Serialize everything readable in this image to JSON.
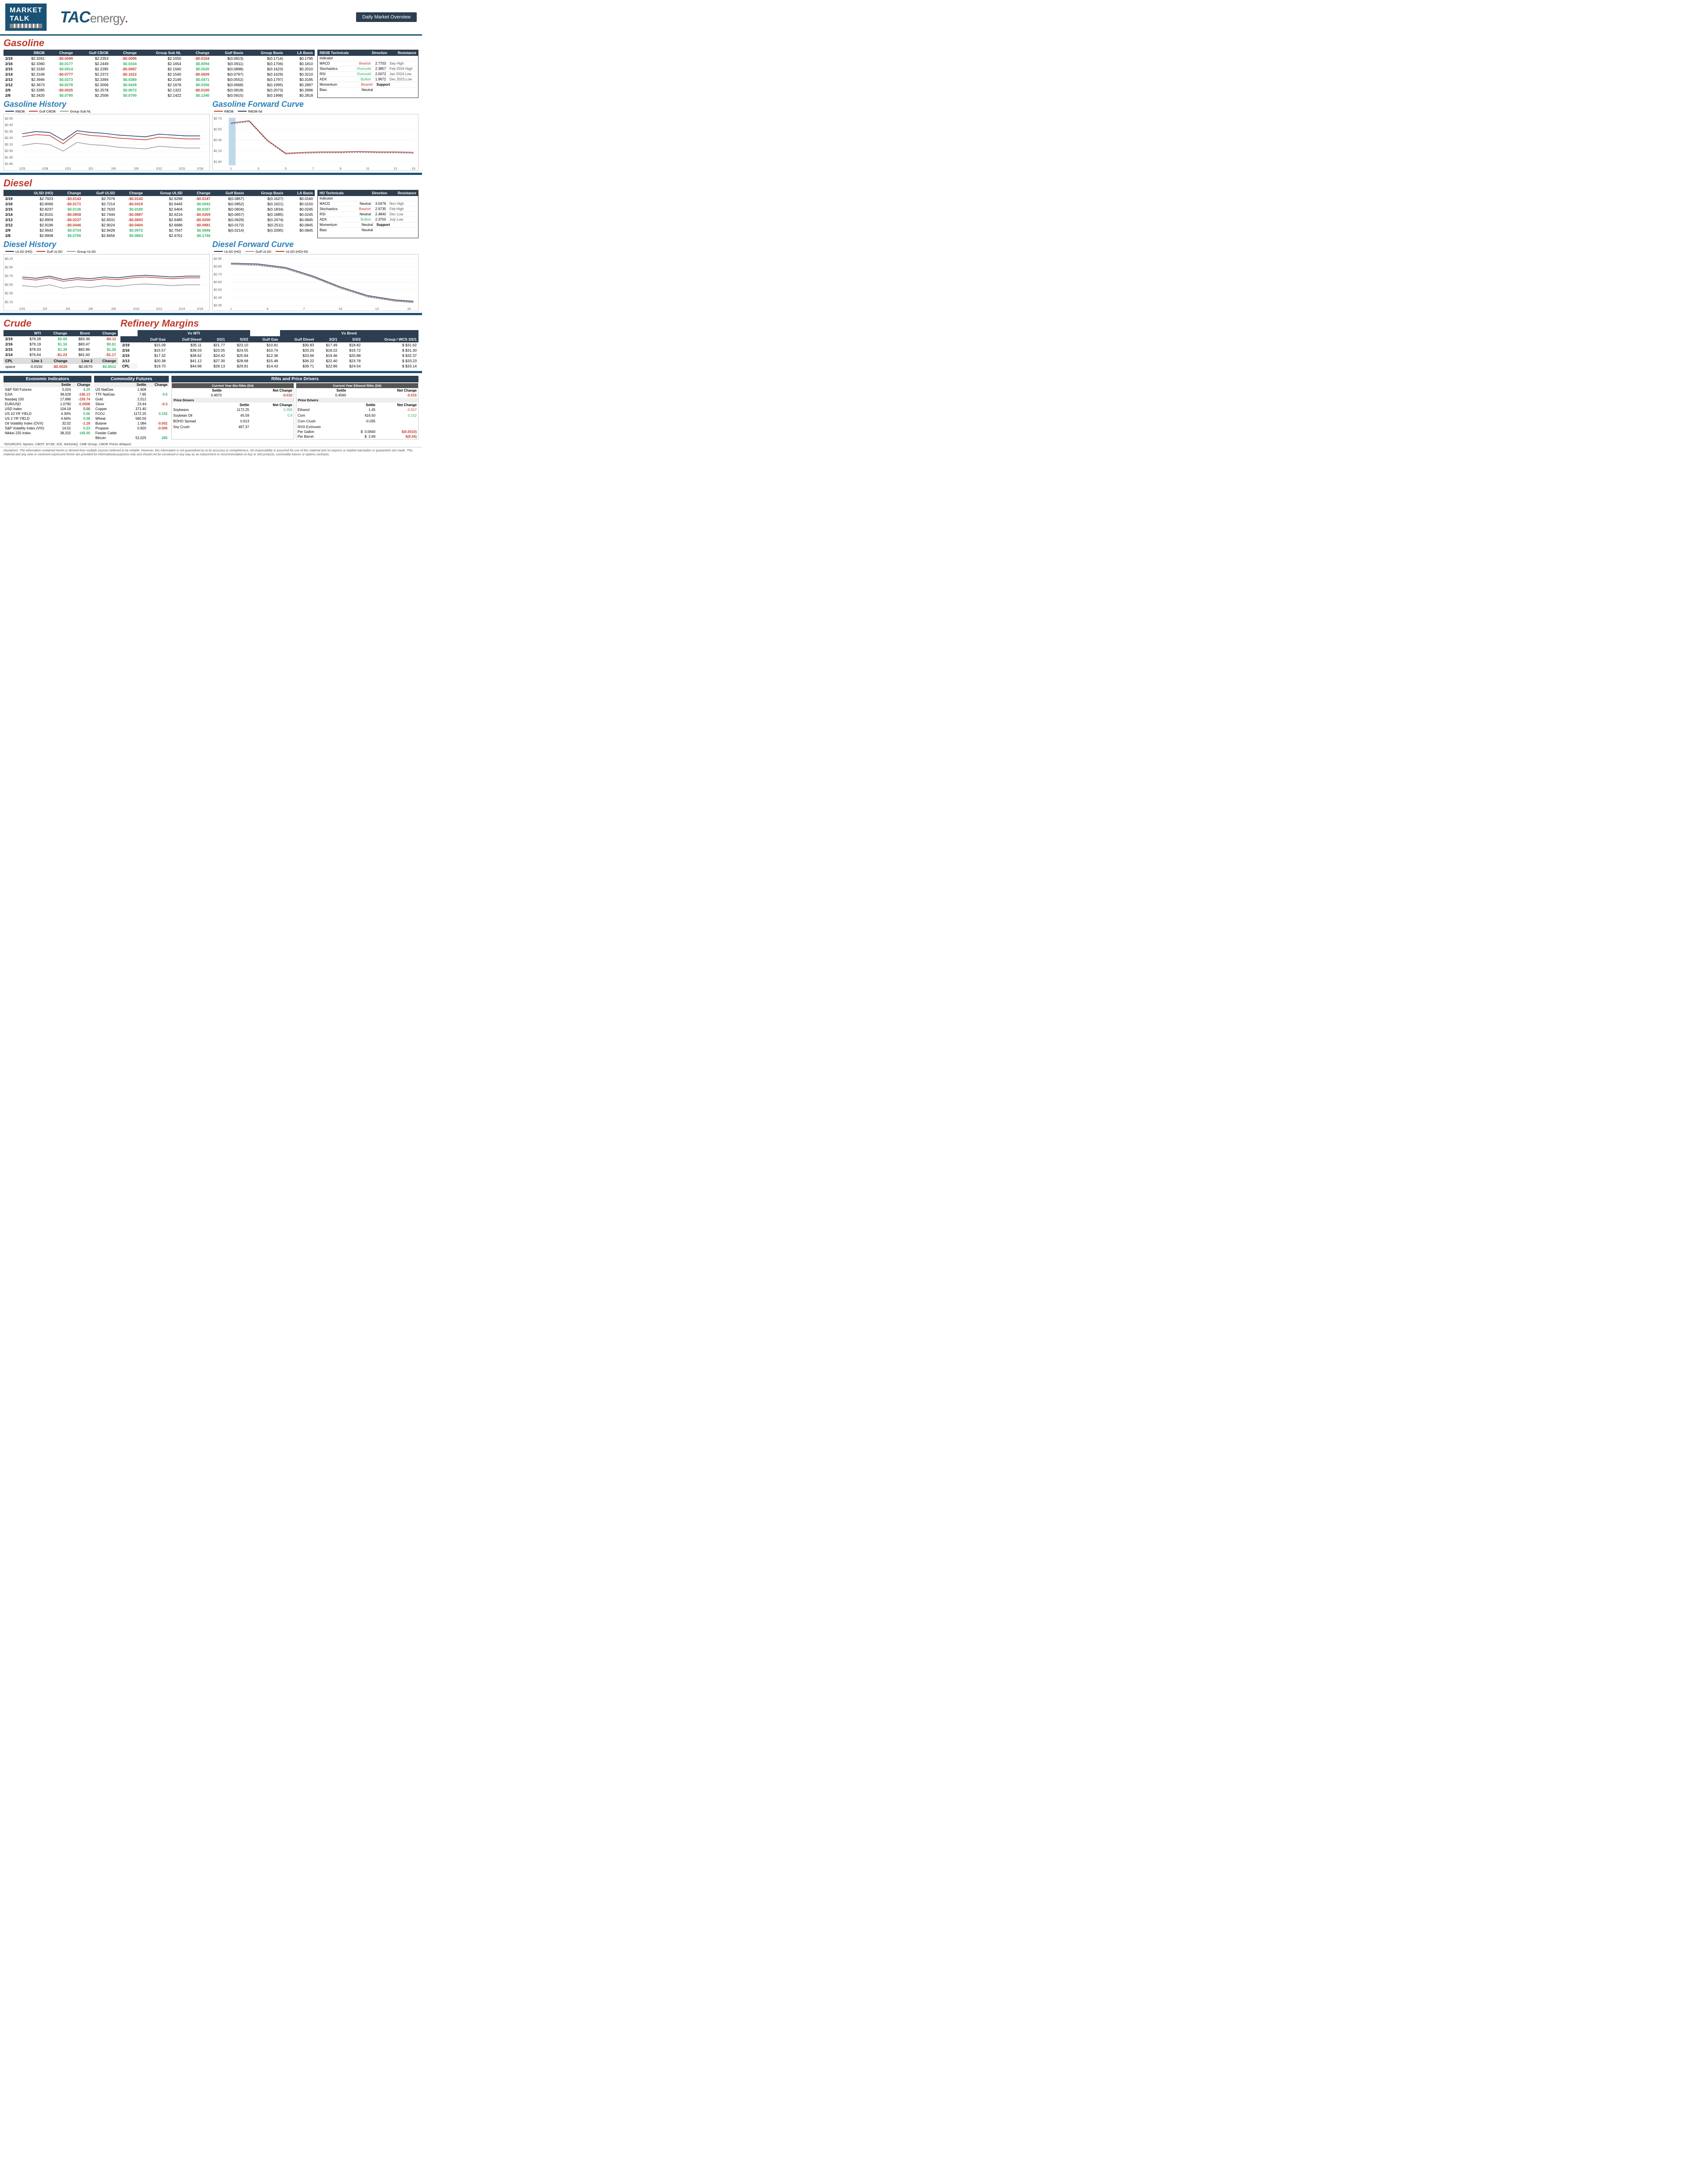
{
  "header": {
    "market_talk": "MARKET TALK",
    "tac_energy": "TACenergy.",
    "daily_overview": "Daily Market Overview"
  },
  "gasoline": {
    "title": "Gasoline",
    "columns": [
      "",
      "RBOB",
      "Change",
      "Gulf CBOB",
      "Change",
      "Group Sub NL",
      "Change",
      "Gulf Basis",
      "Group Basis",
      "LA Basis"
    ],
    "rows": [
      {
        "date": "2/19",
        "rbob": "$2.3261",
        "rbob_chg": "-$0.0099",
        "gulf_cbob": "$2.2353",
        "gulf_cbob_chg": "-$0.0096",
        "group_nl": "$2.1550",
        "group_nl_chg": "-$0.0104",
        "gulf_basis": "$(0.0913)",
        "group_basis": "$(0.1714)",
        "la_basis": "$0.1795"
      },
      {
        "date": "2/16",
        "rbob": "$2.3360",
        "rbob_chg": "$0.0177",
        "gulf_cbob": "$2.2449",
        "gulf_cbob_chg": "$0.0164",
        "group_nl": "$2.1654",
        "group_nl_chg": "$0.0094",
        "gulf_basis": "$(0.0911)",
        "group_basis": "$(0.1706)",
        "la_basis": "$0.1810"
      },
      {
        "date": "2/15",
        "rbob": "$2.3183",
        "rbob_chg": "$0.0014",
        "gulf_cbob": "$2.2285",
        "gulf_cbob_chg": "-$0.0087",
        "group_nl": "$2.1560",
        "group_nl_chg": "$0.0020",
        "gulf_basis": "$(0.0898)",
        "group_basis": "$(0.1623)",
        "la_basis": "$0.2010"
      },
      {
        "date": "2/14",
        "rbob": "$2.3169",
        "rbob_chg": "-$0.0777",
        "gulf_cbob": "$2.2372",
        "gulf_cbob_chg": "-$0.1022",
        "group_nl": "$2.1540",
        "group_nl_chg": "-$0.0609",
        "gulf_basis": "$(0.0797)",
        "group_basis": "$(0.1629)",
        "la_basis": "$0.3210"
      },
      {
        "date": "2/13",
        "rbob": "$2.3946",
        "rbob_chg": "$0.0273",
        "gulf_cbob": "$2.3394",
        "gulf_cbob_chg": "$0.0389",
        "group_nl": "$2.2149",
        "group_nl_chg": "$0.0471",
        "gulf_basis": "$(0.0552)",
        "group_basis": "$(0.1797)",
        "la_basis": "$0.3195"
      },
      {
        "date": "2/12",
        "rbob": "$2.3673",
        "rbob_chg": "$0.0278",
        "gulf_cbob": "$2.3006",
        "gulf_cbob_chg": "$0.0428",
        "group_nl": "$2.1678",
        "group_nl_chg": "$0.0356",
        "gulf_basis": "$(0.0668)",
        "group_basis": "$(0.1995)",
        "la_basis": "$0.2897"
      },
      {
        "date": "2/9",
        "rbob": "$2.3395",
        "rbob_chg": "-$0.0025",
        "gulf_cbob": "$2.2578",
        "gulf_cbob_chg": "$0.0072",
        "group_nl": "$2.1322",
        "group_nl_chg": "-$0.0100",
        "gulf_basis": "$(0.0818)",
        "group_basis": "$(0.2073)",
        "la_basis": "$0.2896"
      },
      {
        "date": "2/8",
        "rbob": "$2.3420",
        "rbob_chg": "$0.0790",
        "gulf_cbob": "$2.2506",
        "gulf_cbob_chg": "$0.0790",
        "group_nl": "$2.1422",
        "group_nl_chg": "$0.1340",
        "gulf_basis": "$(0.0915)",
        "group_basis": "$(0.1998)",
        "la_basis": "$0.2818"
      }
    ],
    "technicals": {
      "title": "RBOB Technicals",
      "headers": [
        "Indicator",
        "Direction",
        "Resistance"
      ],
      "rows": [
        {
          "indicator": "MACD",
          "direction": "Bearish",
          "value": "2.7703",
          "label": "Sep High"
        },
        {
          "indicator": "Stochastics",
          "direction": "Oversold",
          "value": "2.3857",
          "label": "Feb 2024 High"
        },
        {
          "indicator": "RSI",
          "direction": "Oversold",
          "value": "2.0072",
          "label": "Jan 2024 Low"
        },
        {
          "indicator": "ADX",
          "direction": "Bullish",
          "value": "1.9672",
          "label": "Dec 2023 Low"
        }
      ],
      "momentum": {
        "indicator": "Momentum",
        "direction": "Bearish",
        "section": "Support"
      },
      "bias": {
        "indicator": "Bias:",
        "direction": "Neutral"
      }
    },
    "history_title": "Gasoline History",
    "forward_title": "Gasoline Forward Curve",
    "chart": {
      "legend": [
        "RBOB",
        "Gulf CBOB",
        "Group Sub NL"
      ],
      "y_labels": [
        "$2.50",
        "$2.40",
        "$2.30",
        "$2.20",
        "$2.10",
        "$2.00",
        "$1.90",
        "$1.80",
        "$1.70"
      ],
      "x_labels": [
        "1/25",
        "1/28",
        "1/31",
        "2/3",
        "2/6",
        "2/9",
        "2/12",
        "2/15",
        "2/18"
      ]
    },
    "forward_chart": {
      "legend": [
        "RBOB",
        "RBOB-5d"
      ],
      "y_labels": [
        "$2.70",
        "$2.50",
        "$2.30",
        "$2.10",
        "$1.90"
      ],
      "x_labels": [
        "1",
        "3",
        "5",
        "7",
        "9",
        "11",
        "13",
        "15"
      ]
    }
  },
  "diesel": {
    "title": "Diesel",
    "columns": [
      "",
      "ULSD (HO)",
      "Change",
      "Gulf ULSD",
      "Change",
      "Group ULSD",
      "Change",
      "Gulf Basis",
      "Group Basis",
      "LA Basis"
    ],
    "rows": [
      {
        "date": "2/19",
        "ulsd": "$2.7923",
        "ulsd_chg": "-$0.0143",
        "gulf_ulsd": "$2.7076",
        "gulf_chg": "-$0.0143",
        "group_ulsd": "$2.6298",
        "group_chg": "-$0.0147",
        "gulf_basis": "$(0.0857)",
        "group_basis": "$(0.1627)",
        "la_basis": "$0.0160"
      },
      {
        "date": "2/16",
        "ulsd": "$2.8066",
        "ulsd_chg": "-$0.0171",
        "gulf_ulsd": "$2.7214",
        "gulf_chg": "-$0.0419",
        "group_ulsd": "$2.6445",
        "group_chg": "$0.0042",
        "gulf_basis": "$(0.0852)",
        "group_basis": "$(0.1621)",
        "la_basis": "$0.0150"
      },
      {
        "date": "2/15",
        "ulsd": "$2.8237",
        "ulsd_chg": "$0.0136",
        "gulf_ulsd": "$2.7633",
        "gulf_chg": "$0.0189",
        "group_ulsd": "$2.6404",
        "group_chg": "$0.0187",
        "gulf_basis": "$(0.0604)",
        "group_basis": "$(0.1834)",
        "la_basis": "$0.0245"
      },
      {
        "date": "2/14",
        "ulsd": "$2.8101",
        "ulsd_chg": "-$0.0858",
        "gulf_ulsd": "$2.7444",
        "gulf_chg": "-$0.0887",
        "group_ulsd": "$2.6216",
        "group_chg": "-$0.0269",
        "gulf_basis": "$(0.0657)",
        "group_basis": "$(0.1885)",
        "la_basis": "$0.0245"
      },
      {
        "date": "2/13",
        "ulsd": "$2.8959",
        "ulsd_chg": "-$0.0237",
        "gulf_ulsd": "$2.8331",
        "gulf_chg": "-$0.0693",
        "group_ulsd": "$2.6485",
        "group_chg": "-$0.0200",
        "gulf_basis": "$(0.0629)",
        "group_basis": "$(0.2474)",
        "la_basis": "$0.0845"
      },
      {
        "date": "2/12",
        "ulsd": "$2.9196",
        "ulsd_chg": "-$0.0446",
        "gulf_ulsd": "$2.9024",
        "gulf_chg": "-$0.0404",
        "group_ulsd": "$2.6686",
        "group_chg": "-$0.0881",
        "gulf_basis": "$(0.0172)",
        "group_basis": "$(0.2511)",
        "la_basis": "$0.0845"
      },
      {
        "date": "2/9",
        "ulsd": "$2.9642",
        "ulsd_chg": "$0.0734",
        "gulf_ulsd": "$2.9428",
        "gulf_chg": "$0.0972",
        "group_ulsd": "$2.7547",
        "group_chg": "$0.0846",
        "gulf_basis": "$(0.0214)",
        "group_basis": "$(0.2095)",
        "la_basis": "$0.0845"
      },
      {
        "date": "2/8",
        "ulsd": "$2.8908",
        "ulsd_chg": "$0.0756",
        "gulf_ulsd": "$2.8456",
        "gulf_chg": "$0.0863",
        "group_ulsd": "$2.6701",
        "group_chg": "$0.1746",
        "gulf_basis": "",
        "group_basis": "",
        "la_basis": ""
      }
    ],
    "technicals": {
      "title": "HO Technicals",
      "headers": [
        "Indicator",
        "Direction",
        "Resistance"
      ],
      "rows": [
        {
          "indicator": "MACD",
          "direction": "Neutral",
          "value": "3.0476",
          "label": "Nov High"
        },
        {
          "indicator": "Stochastics",
          "direction": "Bearish",
          "value": "2.9735",
          "label": "Feb High"
        },
        {
          "indicator": "RSI",
          "direction": "Neutral",
          "value": "2.4840",
          "label": "Dec Low"
        },
        {
          "indicator": "ADX",
          "direction": "Bullish",
          "value": "2.3750",
          "label": "July Low"
        }
      ],
      "momentum": {
        "indicator": "Momentum",
        "direction": "Neutral",
        "section": "Support"
      },
      "bias": {
        "indicator": "Bias:",
        "direction": "Neutral"
      }
    },
    "history_title": "Diesel History",
    "forward_title": "Diesel Forward Curve",
    "chart": {
      "legend": [
        "ULSD (HO)",
        "Gulf ULSD",
        "Group ULSD"
      ],
      "y_labels": [
        "$3.15",
        "$2.95",
        "$2.75",
        "$2.55",
        "$2.35",
        "$2.15"
      ],
      "x_labels": [
        "1/31",
        "2/2",
        "2/4",
        "2/6",
        "2/8",
        "2/10",
        "2/12",
        "2/14",
        "2/16"
      ]
    },
    "forward_chart": {
      "legend": [
        "ULSD (HO)",
        "Gulf ULSD",
        "ULSD (HO)-5D"
      ],
      "y_labels": [
        "$2.90",
        "$2.80",
        "$2.70",
        "$2.60",
        "$2.50",
        "$2.40",
        "$2.30"
      ],
      "x_labels": [
        "1",
        "4",
        "7",
        "10",
        "13",
        "16"
      ]
    }
  },
  "crude": {
    "title": "Crude",
    "columns": [
      "",
      "WTI",
      "Change",
      "Brent",
      "Change"
    ],
    "rows": [
      {
        "date": "2/19",
        "wti": "$79.28",
        "wti_chg": "$0.09",
        "brent": "$83.36",
        "brent_chg": "-$0.11"
      },
      {
        "date": "2/16",
        "wti": "$79.19",
        "wti_chg": "$1.16",
        "brent": "$83.47",
        "brent_chg": "$0.61"
      },
      {
        "date": "2/15",
        "wti": "$78.03",
        "wti_chg": "$1.39",
        "brent": "$82.86",
        "brent_chg": "$1.26"
      },
      {
        "date": "2/14",
        "wti": "$76.64",
        "wti_chg": "-$1.23",
        "brent": "$81.60",
        "brent_chg": "-$1.17"
      }
    ],
    "cpl": {
      "label": "CPL",
      "line1": "Line 1",
      "line1_val": "-0.0150",
      "line1_chg": "-$0.0025",
      "line2": "Line 2",
      "line2_val": "-$0.0070",
      "line2_chg": "$0.0012",
      "space": "space"
    }
  },
  "refinery_margins": {
    "title": "Refinery Margins",
    "vs_wti_header": "Vs WTI",
    "vs_brent_header": "Vs Brent",
    "columns_wti": [
      "",
      "Gulf Gas",
      "Gulf Diesel",
      "3/2/1",
      "5/3/2"
    ],
    "columns_brent": [
      "Gulf Gas",
      "Gulf Diesel",
      "3/2/1",
      "5/3/2",
      "Group / WCS 3/2/1"
    ],
    "rows": [
      {
        "date": "2/19",
        "wti_ggas": "$15.09",
        "wti_gdiesel": "$35.11",
        "wti_321": "$21.77",
        "wti_532": "$23.10",
        "brent_ggas": "$10.81",
        "brent_gdiesel": "$30.83",
        "brent_321": "$17.49",
        "brent_532": "$18.82",
        "grp_wcs": "$31.62"
      },
      {
        "date": "2/16",
        "wti_ggas": "$15.57",
        "wti_gdiesel": "$38.03",
        "wti_321": "$23.05",
        "wti_532": "$24.55",
        "brent_ggas": "$10.74",
        "brent_gdiesel": "$33.20",
        "brent_321": "$18.22",
        "brent_532": "$19.72",
        "grp_wcs": "$31.30"
      },
      {
        "date": "2/15",
        "wti_ggas": "$17.32",
        "wti_gdiesel": "$38.62",
        "wti_321": "$24.42",
        "wti_532": "$25.84",
        "brent_ggas": "$12.36",
        "brent_gdiesel": "$33.66",
        "brent_321": "$19.46",
        "brent_532": "$20.88",
        "grp_wcs": "$32.37"
      },
      {
        "date": "2/13",
        "wti_ggas": "$20.38",
        "wti_gdiesel": "$41.12",
        "wti_321": "$27.30",
        "wti_532": "$28.68",
        "brent_ggas": "$15.48",
        "brent_gdiesel": "$36.22",
        "brent_321": "$22.40",
        "brent_532": "$23.78",
        "grp_wcs": "$33.23"
      },
      {
        "date": "cpl",
        "wti_ggas": "$19.70",
        "wti_gdiesel": "$44.98",
        "wti_321": "$28.13",
        "wti_532": "$29.81",
        "brent_ggas": "$14.43",
        "brent_gdiesel": "$39.71",
        "brent_321": "$22.86",
        "brent_532": "$24.54",
        "grp_wcs": "$33.14"
      }
    ]
  },
  "economic_indicators": {
    "title": "Economic Indicators",
    "rows": [
      {
        "name": "S&P 500 Futures",
        "settle": "5,024",
        "change": "4.25"
      },
      {
        "name": "DJIA",
        "settle": "38,628",
        "change": "-146.13"
      },
      {
        "name": "Nasdaq 100",
        "settle": "17,686",
        "change": "-159.74"
      },
      {
        "name": "EUR/USD",
        "settle": "1.0790",
        "change": "-0.0008"
      },
      {
        "name": "USD Index",
        "settle": "104.18",
        "change": "0.00"
      },
      {
        "name": "US 10 YR YIELD",
        "settle": "4.30%",
        "change": "0.06"
      },
      {
        "name": "US 2 YR YIELD",
        "settle": "4.64%",
        "change": "0.08"
      },
      {
        "name": "Oil Volatility Index (OVX)",
        "settle": "32.02",
        "change": "-1.18"
      },
      {
        "name": "S&P Volatility Index (VIX)",
        "settle": "14.01",
        "change": "0.23"
      },
      {
        "name": "Nikkei 225 Index",
        "settle": "38,315",
        "change": "145.00"
      }
    ]
  },
  "commodity_futures": {
    "title": "Commodity Futures",
    "rows": [
      {
        "name": "US NatGas",
        "settle": "1.609",
        "change": ""
      },
      {
        "name": "TTF NatGas",
        "settle": "7.85",
        "change": "0.0"
      },
      {
        "name": "Gold",
        "settle": "2,012",
        "change": ""
      },
      {
        "name": "Silver",
        "settle": "23.44",
        "change": "-0.3"
      },
      {
        "name": "Copper",
        "settle": "371.40",
        "change": ""
      },
      {
        "name": "FCOJ",
        "settle": "1172.25",
        "change": "0.152"
      },
      {
        "name": "Wheat",
        "settle": "560.50",
        "change": ""
      },
      {
        "name": "Butane",
        "settle": "1.084",
        "change": "-0.002"
      },
      {
        "name": "Propane",
        "settle": "0.920",
        "change": "-0.006"
      },
      {
        "name": "Feeder Cattle",
        "settle": "",
        "change": ""
      },
      {
        "name": "Bitcoin",
        "settle": "52,025",
        "change": "285"
      }
    ]
  },
  "rins": {
    "title": "RINs and Price Drivers",
    "bio_rins_title": "Current Year Bio RINs (D4)",
    "ethanol_rins_title": "Current Year Ethanol RINs (D6)",
    "bio_settle": "0.4670",
    "bio_net_change": "-0.010",
    "eth_settle": "0.4560",
    "eth_net_change": "-0.015",
    "price_drivers_left": [
      {
        "name": "Soybeans",
        "settle": "1172.25",
        "net_change": ""
      },
      {
        "name": "Soybean Oil",
        "settle": "45.59",
        "net_change": ""
      },
      {
        "name": "BOHO Spread",
        "settle": "0.613",
        "net_change": ""
      },
      {
        "name": "Soy Crush",
        "settle": "497.37",
        "net_change": ""
      }
    ],
    "price_drivers_right": [
      {
        "name": "Ethanol",
        "settle": "1.45",
        "net_change": ""
      },
      {
        "name": "Corn",
        "settle": "416.50",
        "net_change": ""
      },
      {
        "name": "Corn Crush",
        "settle": "-0.035",
        "net_change": ""
      }
    ],
    "rvo_estimate": "RVO Estimate",
    "per_gallon": "Per Gallon",
    "per_gallon_val": "$   0.0640",
    "per_gallon_chg": "$(0.0010)",
    "per_barrel": "Per Barrel",
    "per_barrel_val": "$   2.69",
    "per_barrel_chg": "$(0.04)"
  },
  "sources": "*SOURCES: Nymex, CBOT, NYSE, ICE, NASDAQ, CME Group, CBOE   Prices delayed.",
  "disclaimer": "Disclaimer: The information contained herein is derived from multiple sources believed to be reliable. However, this information is not guaranteed as to its accuracy or completeness. No responsibility is assumed for use of this material and no express or implied warranties or guarantees are made. This material and any view or comment expressed herein are provided for informational purposes only and should not be construed in any way as an inducement or recommendation to buy or sell products, commodity futures or options contracts."
}
